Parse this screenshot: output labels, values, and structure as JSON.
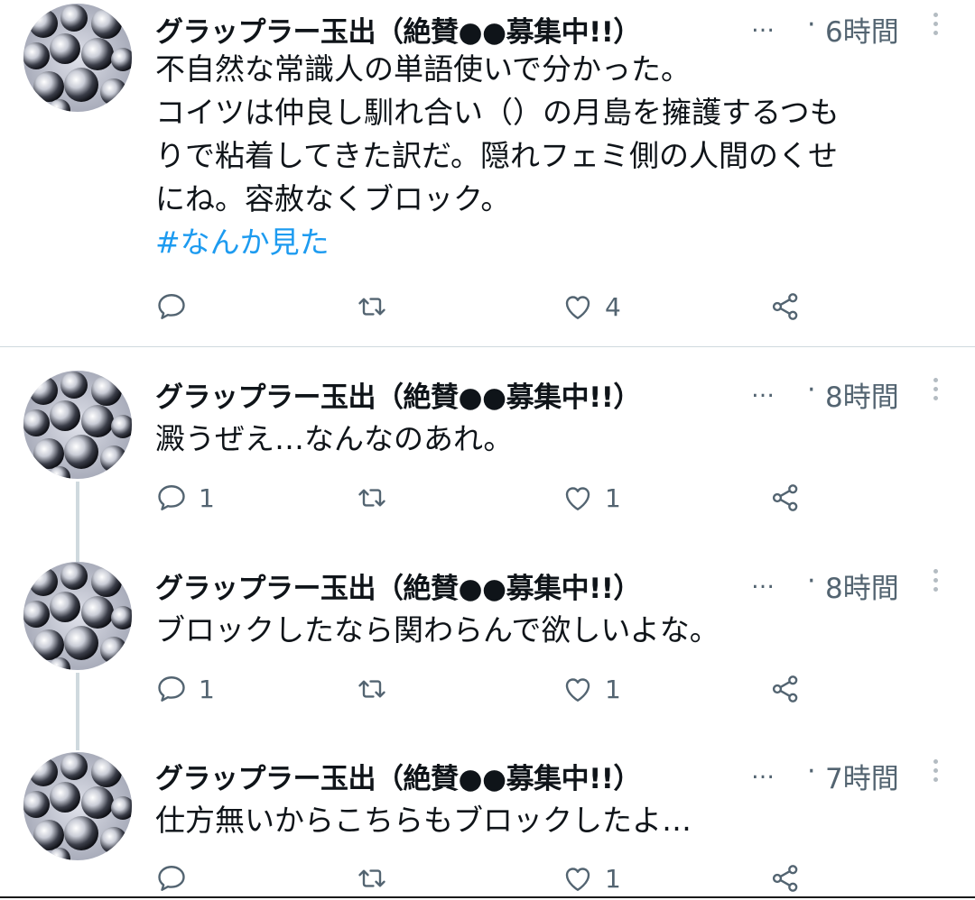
{
  "tweets": [
    {
      "name": "グラップラー玉出（絶賛●●募集中!!）",
      "ellipsis": "…",
      "dot": "·",
      "time": "6時間",
      "lines": [
        "不自然な常識人の単語使いで分かった。",
        "コイツは仲良し馴れ合い（）の月島を擁護するつも",
        "りで粘着してきた訳だ。隠れフェミ側の人間のくせ",
        "にね。容赦なくブロック。"
      ],
      "hashtag": "#なんか見た",
      "reply_count": "",
      "retweet_count": "",
      "like_count": "4"
    },
    {
      "name": "グラップラー玉出（絶賛●●募集中!!）",
      "ellipsis": "…",
      "dot": "·",
      "time": "8時間",
      "lines": [
        "澱うぜえ…なんなのあれ。"
      ],
      "reply_count": "1",
      "retweet_count": "",
      "like_count": "1"
    },
    {
      "name": "グラップラー玉出（絶賛●●募集中!!）",
      "ellipsis": "…",
      "dot": "·",
      "time": "8時間",
      "lines": [
        "ブロックしたなら関わらんで欲しいよな。"
      ],
      "reply_count": "1",
      "retweet_count": "",
      "like_count": "1"
    },
    {
      "name": "グラップラー玉出（絶賛●●募集中!!）",
      "ellipsis": "…",
      "dot": "·",
      "time": "7時間",
      "lines": [
        "仕方無いからこちらもブロックしたよ…"
      ],
      "reply_count": "",
      "retweet_count": "",
      "like_count": "1"
    }
  ],
  "icons": {
    "reply": "reply-icon",
    "retweet": "retweet-icon",
    "like": "heart-icon",
    "share": "share-icon",
    "more": "more-vertical-icon"
  },
  "colors": {
    "hashtag": "#1d9bf0",
    "secondary_text": "#536471",
    "divider": "#cfd9de"
  }
}
